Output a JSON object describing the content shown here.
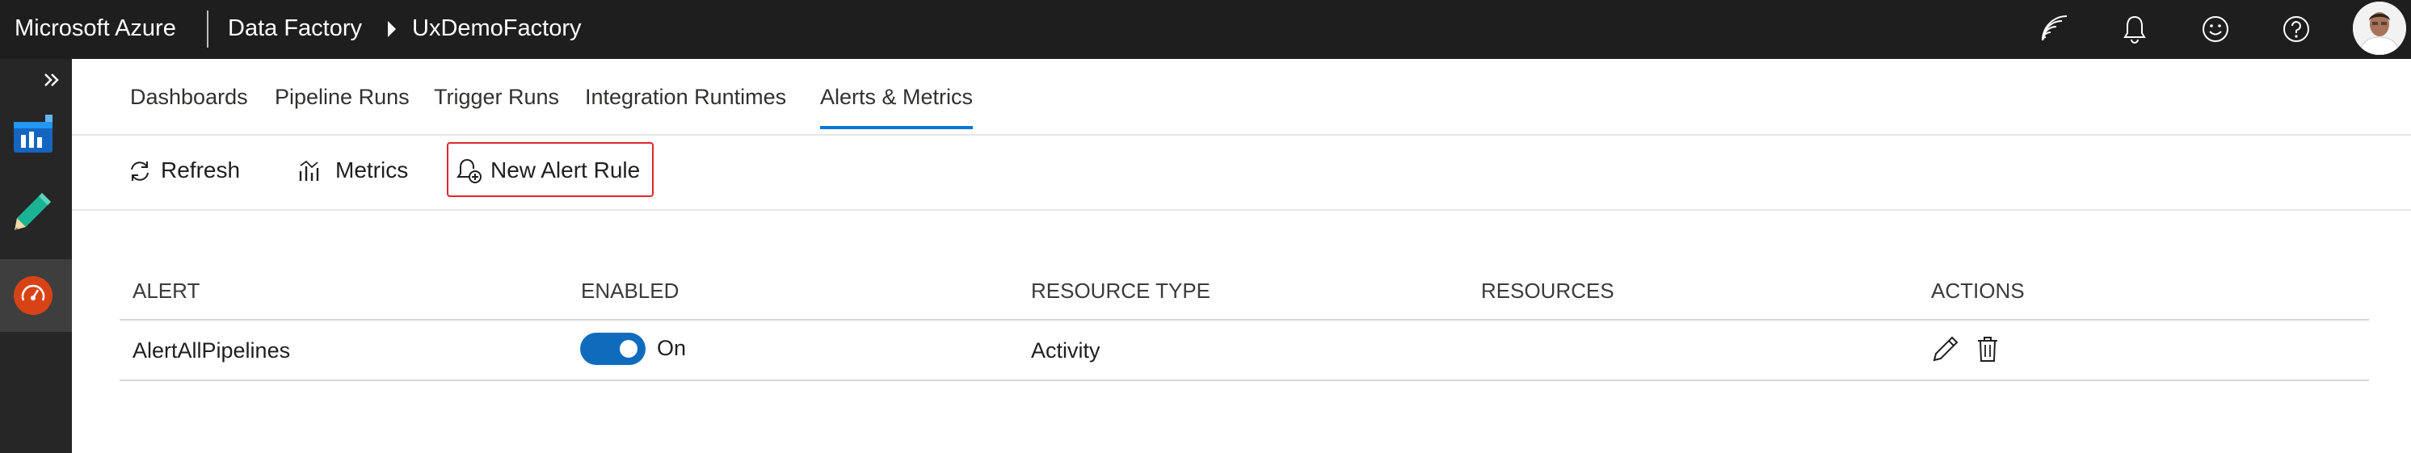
{
  "header": {
    "product": "Microsoft Azure",
    "service": "Data Factory",
    "resource": "UxDemoFactory",
    "icons": [
      "feedback-signal-icon",
      "notifications-bell-icon",
      "smiley-icon",
      "help-icon",
      "user-avatar"
    ]
  },
  "rail": {
    "items": [
      "monitor-dashboard-icon",
      "author-pencil-icon",
      "monitor-gauge-icon"
    ],
    "active": "monitor-gauge-icon"
  },
  "tabs": [
    {
      "label": "Dashboards"
    },
    {
      "label": "Pipeline Runs"
    },
    {
      "label": "Trigger Runs"
    },
    {
      "label": "Integration Runtimes"
    },
    {
      "label": "Alerts & Metrics"
    }
  ],
  "selected_tab": "Alerts & Metrics",
  "toolbar": {
    "refresh": "Refresh",
    "metrics": "Metrics",
    "new_alert_rule": "New Alert Rule"
  },
  "table": {
    "columns": [
      "ALERT",
      "ENABLED",
      "RESOURCE TYPE",
      "RESOURCES",
      "ACTIONS"
    ],
    "rows": [
      {
        "alert": "AlertAllPipelines",
        "enabled_label": "On",
        "resource_type": "Activity",
        "resources": ""
      }
    ]
  },
  "colors": {
    "accent": "#0078d4",
    "toggle_on": "#0f6cbd",
    "highlight_border": "#e0262f",
    "topbar": "#1e1e1e"
  }
}
